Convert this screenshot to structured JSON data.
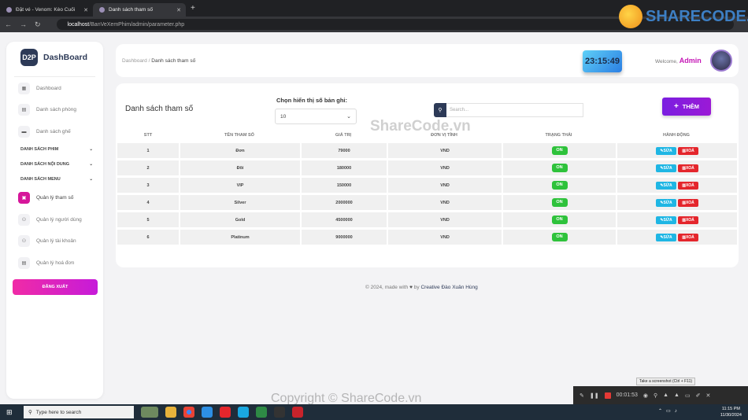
{
  "browser": {
    "tabs": [
      {
        "label": "Đặt vé - Venom: Kèo Cuối"
      },
      {
        "label": "Danh sách tham số"
      }
    ],
    "url_host": "localhost",
    "url_path": "/BanVeXemPhim/admin/parameter.php"
  },
  "sidebar": {
    "brand": "DashBoard",
    "logo_text": "D2P",
    "items": [
      {
        "label": "Dashboard",
        "icon": "store-icon"
      },
      {
        "label": "Danh sách phòng",
        "icon": "room-icon"
      },
      {
        "label": "Danh sách ghế",
        "icon": "seat-icon"
      }
    ],
    "sections": [
      {
        "label": "DANH SÁCH PHIM"
      },
      {
        "label": "DANH SÁCH NỘI DUNG"
      },
      {
        "label": "DANH SÁCH MENU"
      }
    ],
    "sub_items": [
      {
        "label": "Quản lý tham số",
        "active": true
      },
      {
        "label": "Quản lý người dùng"
      },
      {
        "label": "Quản lý tài khoản"
      },
      {
        "label": "Quản lý hoá đơn"
      }
    ],
    "logout": "ĐĂNG XUẤT"
  },
  "header": {
    "breadcrumb_root": "Dashboard",
    "breadcrumb_sep": "/",
    "breadcrumb_current": "Danh sách tham số",
    "clock": "23:15:49",
    "welcome": "Welcome,",
    "user": "Admin"
  },
  "main": {
    "title": "Danh sách tham số",
    "page_size_label": "Chọn hiển thị số bản ghi:",
    "page_size_value": "10",
    "search_placeholder": "Search...",
    "add_button": "THÊM",
    "columns": [
      "STT",
      "TÊN THAM SỐ",
      "GIÁ TRỊ",
      "ĐƠN VỊ TÍNH",
      "TRẠNG THÁI",
      "HÀNH ĐỘNG"
    ],
    "rows": [
      {
        "stt": "1",
        "name": "Đơn",
        "value": "79000",
        "unit": "VND",
        "status": "ON"
      },
      {
        "stt": "2",
        "name": "Đôi",
        "value": "180000",
        "unit": "VND",
        "status": "ON"
      },
      {
        "stt": "3",
        "name": "VIP",
        "value": "150000",
        "unit": "VND",
        "status": "ON"
      },
      {
        "stt": "4",
        "name": "Silver",
        "value": "2000000",
        "unit": "VND",
        "status": "ON"
      },
      {
        "stt": "5",
        "name": "Gold",
        "value": "4500000",
        "unit": "VND",
        "status": "ON"
      },
      {
        "stt": "6",
        "name": "Platinum",
        "value": "9000000",
        "unit": "VND",
        "status": "ON"
      }
    ],
    "edit_label": "SỬA",
    "delete_label": "XOÁ"
  },
  "footer": {
    "text": "© 2024, made with",
    "by": "by",
    "author": "Creative Đào Xuân Hùng"
  },
  "recorder": {
    "time": "00:01:53",
    "tooltip": "Take a screenshot (Ctrl + F11)"
  },
  "taskbar": {
    "search_placeholder": "Type here to search",
    "time": "11:15 PM",
    "date": "11/30/2024"
  },
  "watermarks": {
    "center": "ShareCode.vn",
    "bottom": "Copyright © ShareCode.vn",
    "logo": "SHARECODE.vn"
  },
  "colors": {
    "accent": "#d6169a",
    "primary_dark": "#2d3a57",
    "add_button": "#7a1ee0",
    "status_on": "#2ec23b",
    "edit": "#1fb6e4",
    "delete": "#e4262c"
  }
}
